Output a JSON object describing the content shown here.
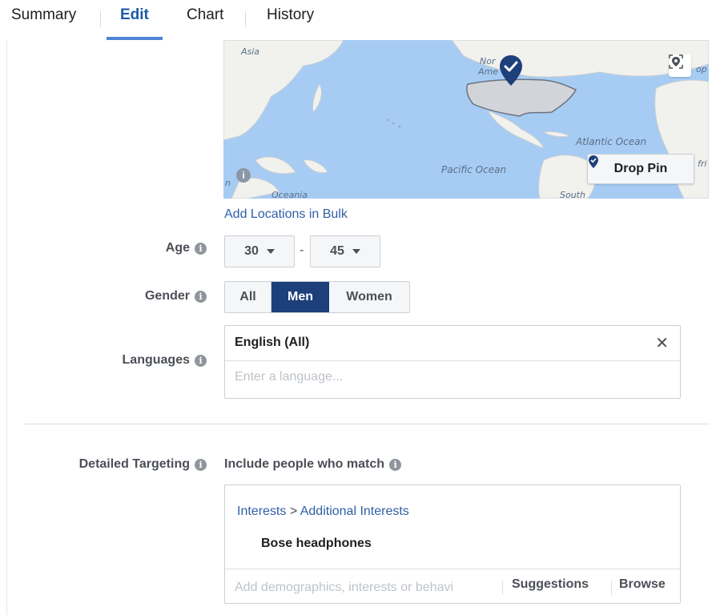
{
  "tabs": [
    {
      "label": "Summary"
    },
    {
      "label": "Edit"
    },
    {
      "label": "Chart"
    },
    {
      "label": "History"
    }
  ],
  "active_tab": "Edit",
  "map": {
    "labels": {
      "asia": "Asia",
      "north_america_1": "Nor",
      "north_america_2": "Ame",
      "pacific": "Pacific Ocean",
      "atlantic": "Atlantic Ocean",
      "oceania": "Oceania",
      "south": "South",
      "edge_right_top": "op",
      "edge_right_mid": "fri",
      "edge_left": "n"
    },
    "drop_pin_label": "Drop Pin",
    "info_glyph": "i"
  },
  "add_locations_bulk": "Add Locations in Bulk",
  "info_glyph": "i",
  "age": {
    "label": "Age",
    "min": "30",
    "max": "45",
    "separator": "-"
  },
  "gender": {
    "label": "Gender",
    "options": [
      "All",
      "Men",
      "Women"
    ],
    "selected": "Men"
  },
  "languages": {
    "label": "Languages",
    "selected": "English (All)",
    "remove_glyph": "✕",
    "placeholder": "Enter a language..."
  },
  "detailed_targeting": {
    "label": "Detailed Targeting",
    "include_text": "Include people who match",
    "breadcrumb_parent": "Interests",
    "breadcrumb_sep": ">",
    "breadcrumb_child": "Additional Interests",
    "interest": "Bose headphones",
    "placeholder": "Add demographics, interests or behavi",
    "suggestions": "Suggestions",
    "browse": "Browse"
  },
  "colors": {
    "accent": "#4e86d6",
    "selected_button": "#1d3f7a",
    "link": "#2f5fa8",
    "map_water": "#a7ccf4",
    "pin": "#1d3f7a"
  }
}
